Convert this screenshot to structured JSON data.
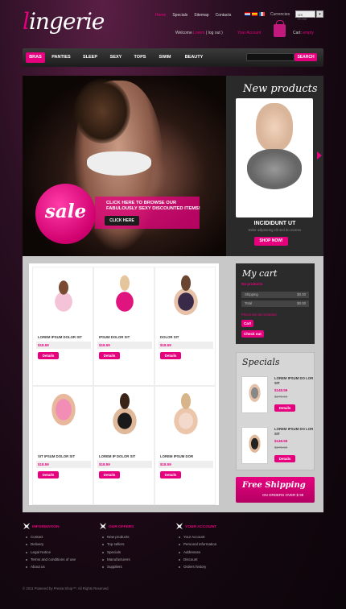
{
  "logo": {
    "text": "ingerie",
    "initial": "l"
  },
  "toplinks": [
    "Home",
    "Specials",
    "Sitemap",
    "Contacts"
  ],
  "currency": {
    "label": "Currencies",
    "selected": "US Dollar",
    "btn": "▾"
  },
  "welcome": {
    "pre": "Welcome",
    "user": "Lorem",
    "post": "( log out )"
  },
  "account": "Your Account",
  "cart": {
    "label": "Cart:",
    "value": "empty"
  },
  "nav": [
    "BRAS",
    "PANTIES",
    "SLEEP",
    "SEXY",
    "TOPS",
    "SWIM",
    "BEAUTY"
  ],
  "search_btn": "SEARCH",
  "banner": {
    "sale": "sale",
    "text": "CLICK HERE TO BROWSE OUR FABULOUSLY SEXY DISCOUNTED ITEMS!",
    "btn": "CLICK HERE"
  },
  "new_products": {
    "title": "New products",
    "name": "INCIDIDUNT UT",
    "desc": "Dolor adipisicing elit sed do eiusmo",
    "btn": "SHOP NOW!"
  },
  "products": [
    {
      "name": "LOREM IPSUM DOLOR SIT",
      "price": "$18.59",
      "btn": "Details"
    },
    {
      "name": "IPSUM DOLOR SIT",
      "price": "$18.59",
      "btn": "Details"
    },
    {
      "name": "DOLOR SIT",
      "price": "$18.59",
      "btn": "Details"
    },
    {
      "name": "SIT IPSUM DOLOR SIT",
      "price": "$18.59",
      "btn": "Details"
    },
    {
      "name": "LOREM IP DOLOR SIT",
      "price": "$18.59",
      "btn": "Details"
    },
    {
      "name": "LOREM IPSUM DOR",
      "price": "$18.59",
      "btn": "Details"
    }
  ],
  "mycart": {
    "title": "My cart",
    "empty": "No products",
    "shipping_label": "Shipping",
    "shipping_val": "$0.00",
    "total_label": "Total",
    "total_val": "$0.00",
    "tax": "Prices are tax included",
    "cart_btn": "Cart",
    "checkout_btn": "Check out"
  },
  "specials": {
    "title": "Specials",
    "items": [
      {
        "name": "LOREM IPSUM DO LOR SIT",
        "new": "$148.59",
        "old": "$179.69",
        "btn": "Details"
      },
      {
        "name": "LOREM IPSUM DO LOR SIT",
        "new": "$148.59",
        "old": "$179.69",
        "btn": "Details"
      }
    ]
  },
  "freeship": {
    "title": "Free Shipping",
    "sub": "ON ORDERS OVER $ 99"
  },
  "footer": [
    {
      "head": "INFORMATION",
      "items": [
        "Contact",
        "Delivery",
        "Legal Notice",
        "Terms and conditions of use",
        "About us"
      ]
    },
    {
      "head": "OUR OFFERS",
      "items": [
        "New products",
        "Top sellers",
        "Specials",
        "Manufacturers",
        "Suppliers"
      ]
    },
    {
      "head": "YOUR ACCOUNT",
      "items": [
        "Your Account",
        "Personal information",
        "Addresses",
        "Discount",
        "Orders history"
      ]
    }
  ],
  "copyright": "© 2011 Powered by Presta Shop™. All Rights Reserved",
  "colors": {
    "accent": "#e6007e"
  }
}
